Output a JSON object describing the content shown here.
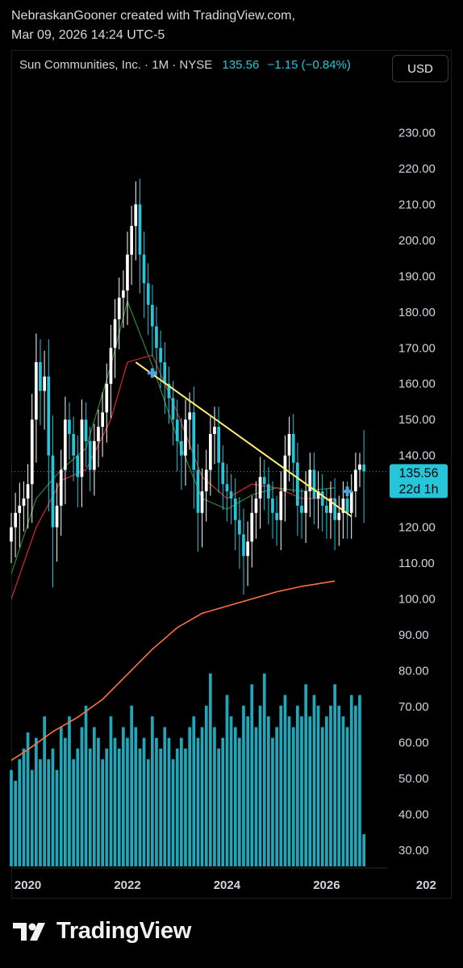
{
  "attribution": {
    "line1": "NebraskanGooner created with TradingView.com,",
    "line2": "Mar 09, 2026 14:24 UTC-5"
  },
  "legend": {
    "symbol": "Sun Communities, Inc. · 1M · NYSE",
    "price": "135.56",
    "change": "−1.15 (−0.84%)"
  },
  "currency_button": "USD",
  "price_tag": {
    "price": "135.56",
    "countdown": "22d 1h"
  },
  "footer": {
    "brand": "TradingView"
  },
  "colors": {
    "background": "#000000",
    "candle_up": "#ffffff",
    "candle_down": "#26c6da",
    "ma_short": "#2e7d32",
    "ma_mid": "#c62828",
    "ma_long": "#ff7043",
    "trendline": "#fff176",
    "volume": "#26c6da",
    "price_tag": "#26c6da"
  },
  "chart_data": {
    "type": "candlestick",
    "y_axis": {
      "range": [
        25,
        240
      ],
      "ticks": [
        "230.00",
        "220.00",
        "210.00",
        "200.00",
        "190.00",
        "180.00",
        "170.00",
        "160.00",
        "150.00",
        "140.00",
        "120.00",
        "110.00",
        "100.00",
        "90.00",
        "80.00",
        "70.00",
        "60.00",
        "50.00",
        "40.00",
        "30.00"
      ]
    },
    "x_axis": {
      "range": [
        "2019-09",
        "2027-04"
      ],
      "ticks": [
        {
          "date": "2020-01",
          "label": "2020"
        },
        {
          "date": "2022-01",
          "label": "2022"
        },
        {
          "date": "2024-01",
          "label": "2024"
        },
        {
          "date": "2026-01",
          "label": "2026"
        },
        {
          "date": "2028-01",
          "label": "202"
        }
      ]
    },
    "last_price": 135.56,
    "series": {
      "candles": {
        "start": "2019-09",
        "interval": "1M",
        "close": [
          120,
          124,
          126,
          128,
          132,
          150,
          166,
          158,
          162,
          140,
          120,
          126,
          136,
          150,
          146,
          140,
          134,
          150,
          144,
          136,
          144,
          148,
          152,
          160,
          170,
          178,
          184,
          186,
          196,
          204,
          210,
          196,
          188,
          182,
          176,
          170,
          166,
          160,
          156,
          150,
          144,
          140,
          150,
          152,
          136,
          124,
          130,
          136,
          146,
          148,
          138,
          132,
          130,
          128,
          122,
          118,
          112,
          116,
          124,
          128,
          134,
          132,
          128,
          124,
          122,
          130,
          140,
          146,
          138,
          126,
          124,
          130,
          136,
          128,
          130,
          126,
          124,
          128,
          122,
          124,
          128,
          124,
          130,
          136,
          137.5,
          135.56
        ],
        "range": [
          10,
          14,
          16,
          12,
          14,
          18,
          20,
          16,
          18,
          26,
          28,
          16,
          14,
          16,
          12,
          12,
          14,
          14,
          12,
          10,
          12,
          12,
          14,
          14,
          16,
          14,
          14,
          14,
          16,
          14,
          16,
          18,
          16,
          14,
          14,
          14,
          12,
          14,
          12,
          12,
          14,
          16,
          14,
          14,
          18,
          18,
          16,
          14,
          12,
          14,
          14,
          12,
          14,
          12,
          14,
          16,
          18,
          14,
          12,
          12,
          14,
          12,
          12,
          12,
          12,
          14,
          14,
          12,
          14,
          14,
          12,
          14,
          12,
          12,
          14,
          12,
          12,
          12,
          14,
          12,
          12,
          12,
          12,
          12,
          8,
          24
        ]
      },
      "volume": {
        "unit": "relative",
        "values": [
          18,
          16,
          20,
          22,
          25,
          18,
          24,
          20,
          28,
          20,
          22,
          18,
          26,
          24,
          28,
          20,
          22,
          26,
          30,
          22,
          26,
          24,
          20,
          22,
          28,
          24,
          22,
          26,
          24,
          30,
          26,
          22,
          24,
          20,
          28,
          24,
          22,
          26,
          24,
          20,
          22,
          24,
          22,
          26,
          28,
          24,
          26,
          30,
          36,
          26,
          22,
          24,
          32,
          28,
          26,
          24,
          30,
          28,
          34,
          26,
          30,
          36,
          28,
          24,
          26,
          30,
          32,
          28,
          26,
          30,
          28,
          34,
          28,
          32,
          30,
          26,
          28,
          30,
          34,
          30,
          28,
          26,
          32,
          30,
          32,
          6
        ]
      },
      "moving_averages": [
        {
          "color": "#2e7d32",
          "points": [
            [
              "2019-09",
              107
            ],
            [
              "2020-03",
              128
            ],
            [
              "2020-09",
              136
            ],
            [
              "2021-03",
              142
            ],
            [
              "2021-09",
              165
            ],
            [
              "2022-01",
              183
            ],
            [
              "2022-07",
              165
            ],
            [
              "2023-01",
              145
            ],
            [
              "2023-07",
              128
            ],
            [
              "2024-01",
              125
            ],
            [
              "2024-07",
              129
            ],
            [
              "2025-01",
              131
            ],
            [
              "2025-07",
              130
            ],
            [
              "2026-03",
              131
            ]
          ]
        },
        {
          "color": "#c62828",
          "points": [
            [
              "2019-09",
              100
            ],
            [
              "2020-03",
              120
            ],
            [
              "2020-09",
              133
            ],
            [
              "2021-03",
              136
            ],
            [
              "2021-09",
              150
            ],
            [
              "2022-01",
              166
            ],
            [
              "2022-07",
              168
            ],
            [
              "2023-01",
              152
            ],
            [
              "2023-07",
              134
            ],
            [
              "2024-01",
              128
            ],
            [
              "2024-07",
              132
            ],
            [
              "2025-01",
              131
            ],
            [
              "2025-07",
              128
            ],
            [
              "2026-03",
              128
            ]
          ]
        },
        {
          "color": "#ff7043",
          "points": [
            [
              "2019-09",
              55
            ],
            [
              "2020-01",
              58
            ],
            [
              "2020-07",
              63
            ],
            [
              "2021-01",
              67
            ],
            [
              "2021-07",
              72
            ],
            [
              "2022-01",
              79
            ],
            [
              "2022-07",
              86
            ],
            [
              "2023-01",
              92
            ],
            [
              "2023-07",
              96
            ],
            [
              "2024-01",
              98
            ],
            [
              "2024-07",
              100
            ],
            [
              "2025-01",
              102
            ],
            [
              "2025-07",
              103.5
            ],
            [
              "2026-03",
              105
            ]
          ]
        }
      ],
      "trendline": {
        "from": {
          "date": "2022-03",
          "value": 166
        },
        "to": {
          "date": "2026-07",
          "value": 123
        }
      },
      "markers": [
        {
          "date": "2022-07",
          "value": 163
        },
        {
          "date": "2026-06",
          "value": 130
        }
      ]
    }
  }
}
